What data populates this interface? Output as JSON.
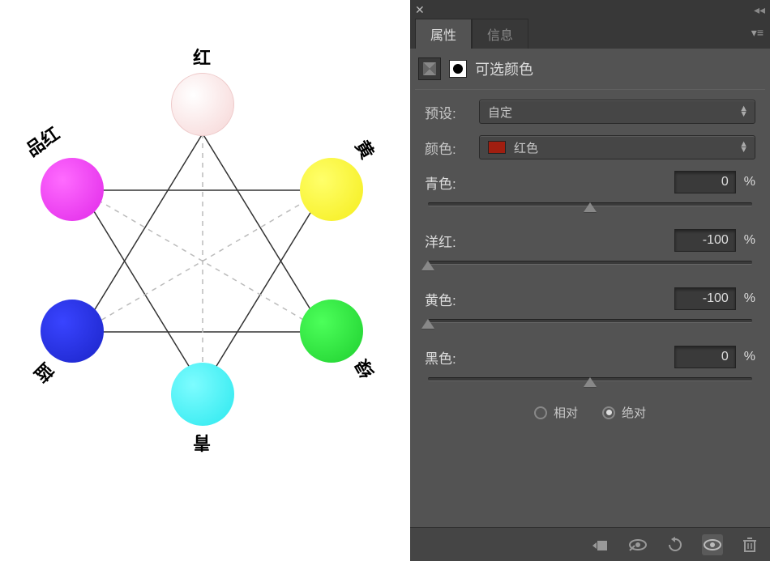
{
  "left": {
    "labels": {
      "red": "红",
      "magenta": "品红",
      "yellow": "黄",
      "blue": "蓝",
      "green": "绿",
      "cyan": "青"
    },
    "colors": {
      "red": "#f6d5d5",
      "magenta": "#e028e8",
      "yellow": "#f5ed1c",
      "blue": "#1b24c8",
      "green": "#1fcf2f",
      "cyan": "#2be8ee"
    }
  },
  "panel": {
    "tabs": {
      "properties": "属性",
      "info": "信息"
    },
    "header": {
      "title": "可选颜色"
    },
    "preset": {
      "label": "预设:",
      "value": "自定"
    },
    "color": {
      "label": "颜色:",
      "value": "红色",
      "swatch": "#a01e10"
    },
    "sliders": {
      "cyan": {
        "label": "青色:",
        "value": "0",
        "pct": "%",
        "pos": 50
      },
      "magenta": {
        "label": "洋红:",
        "value": "-100",
        "pct": "%",
        "pos": 0
      },
      "yellow": {
        "label": "黄色:",
        "value": "-100",
        "pct": "%",
        "pos": 0
      },
      "black": {
        "label": "黑色:",
        "value": "0",
        "pct": "%",
        "pos": 50
      }
    },
    "method": {
      "relative": "相对",
      "absolute": "绝对",
      "selected": "absolute"
    }
  }
}
